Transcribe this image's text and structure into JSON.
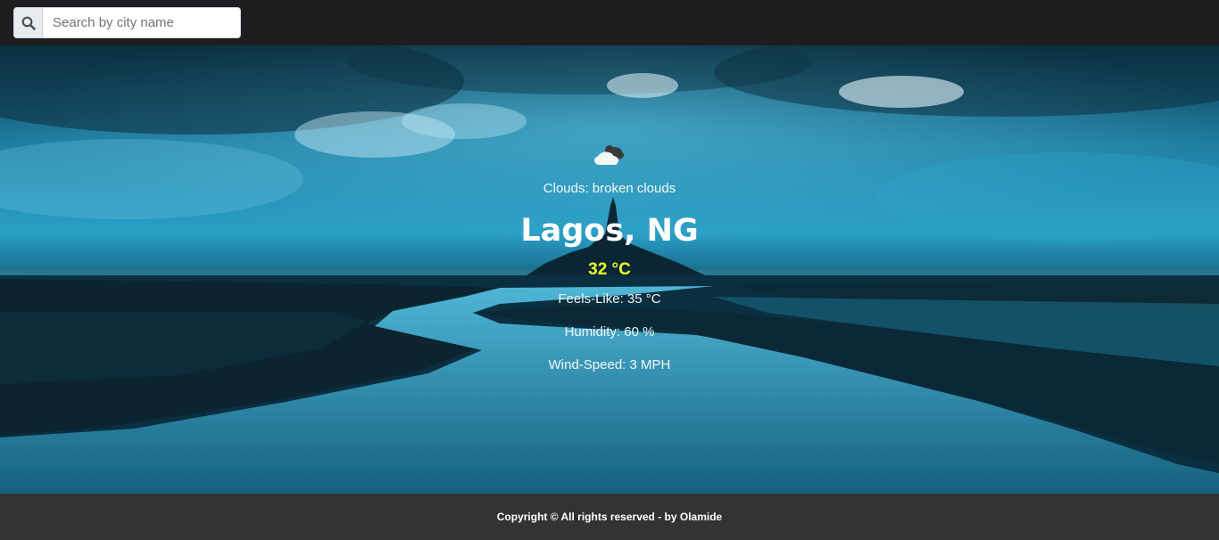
{
  "search": {
    "placeholder": "Search by city name",
    "value": ""
  },
  "weather": {
    "icon": "broken-clouds-icon",
    "description": "Clouds: broken clouds",
    "city": "Lagos, NG",
    "temperature": "32 °C",
    "feels_like": "Feels-Like: 35 °C",
    "humidity": "Humidity: 60 %",
    "wind_speed": "Wind-Speed: 3 MPH"
  },
  "footer": {
    "text": "Copyright © All rights reserved - by Olamide"
  },
  "colors": {
    "topbar": "#1d1d1f",
    "footer": "#333335",
    "temperature": "#e8ff2c",
    "sky": "#2a9fc6"
  }
}
